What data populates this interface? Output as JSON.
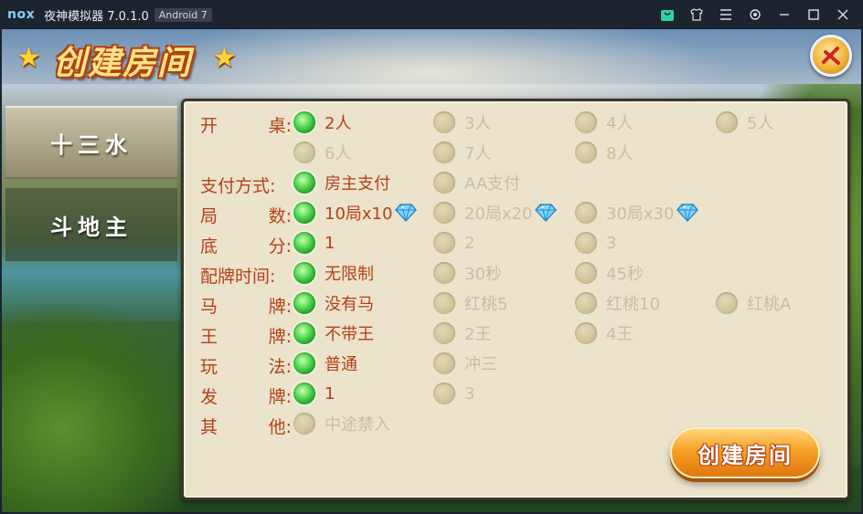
{
  "titlebar": {
    "logo": "nox",
    "title": "夜神模拟器 7.0.1.0",
    "badge": "Android 7",
    "icons": [
      "shop-icon",
      "shirt-icon",
      "menu-icon",
      "gear-icon",
      "minimize-icon",
      "maximize-icon",
      "close-icon"
    ]
  },
  "header": {
    "title": "创建房间"
  },
  "sidebar": {
    "items": [
      {
        "label": "十三水",
        "active": true
      },
      {
        "label": "斗地主",
        "active": false
      }
    ]
  },
  "form": {
    "rows": [
      {
        "label": [
          "开",
          "桌:"
        ],
        "options": [
          {
            "text": "2人",
            "selected": true
          },
          {
            "text": "3人",
            "selected": false
          },
          {
            "text": "4人",
            "selected": false
          },
          {
            "text": "5人",
            "selected": false
          }
        ]
      },
      {
        "label": [
          "",
          ""
        ],
        "options": [
          {
            "text": "6人",
            "selected": false
          },
          {
            "text": "7人",
            "selected": false
          },
          {
            "text": "8人",
            "selected": false
          }
        ]
      },
      {
        "label": [
          "支付方式:",
          ""
        ],
        "options": [
          {
            "text": "房主支付",
            "selected": true
          },
          {
            "text": "AA支付",
            "selected": false
          }
        ]
      },
      {
        "label": [
          "局",
          "数:"
        ],
        "options": [
          {
            "text": "10局x10",
            "selected": true,
            "gem": true
          },
          {
            "text": "20局x20",
            "selected": false,
            "gem": true
          },
          {
            "text": "30局x30",
            "selected": false,
            "gem": true
          }
        ]
      },
      {
        "label": [
          "底",
          "分:"
        ],
        "options": [
          {
            "text": "1",
            "selected": true
          },
          {
            "text": "2",
            "selected": false
          },
          {
            "text": "3",
            "selected": false
          }
        ]
      },
      {
        "label": [
          "配牌时间:",
          ""
        ],
        "options": [
          {
            "text": "无限制",
            "selected": true
          },
          {
            "text": "30秒",
            "selected": false
          },
          {
            "text": "45秒",
            "selected": false
          }
        ]
      },
      {
        "label": [
          "马",
          "牌:"
        ],
        "options": [
          {
            "text": "没有马",
            "selected": true
          },
          {
            "text": "红桃5",
            "selected": false
          },
          {
            "text": "红桃10",
            "selected": false
          },
          {
            "text": "红桃A",
            "selected": false
          }
        ]
      },
      {
        "label": [
          "王",
          "牌:"
        ],
        "options": [
          {
            "text": "不带王",
            "selected": true
          },
          {
            "text": "2王",
            "selected": false
          },
          {
            "text": "4王",
            "selected": false
          }
        ]
      },
      {
        "label": [
          "玩",
          "法:"
        ],
        "options": [
          {
            "text": "普通",
            "selected": true
          },
          {
            "text": "冲三",
            "selected": false
          }
        ]
      },
      {
        "label": [
          "发",
          "牌:"
        ],
        "options": [
          {
            "text": "1",
            "selected": true
          },
          {
            "text": "3",
            "selected": false
          }
        ]
      },
      {
        "label": [
          "其",
          "他:"
        ],
        "options": [
          {
            "text": "中途禁入",
            "selected": false
          }
        ]
      }
    ]
  },
  "create_button": {
    "label": "创建房间"
  },
  "colors": {
    "selected_text": "#b4401c",
    "unselected_text": "#c7bea8",
    "panel_bg": "#ebe3cb",
    "radio_on": "#3dc43a",
    "button": "#f2941c"
  }
}
